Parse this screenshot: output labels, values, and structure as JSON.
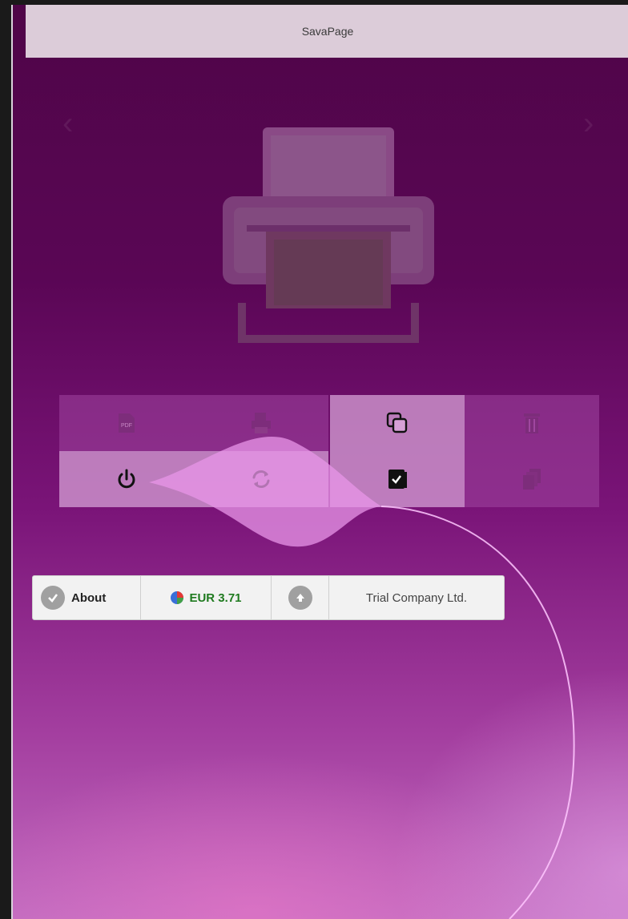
{
  "header": {
    "title": "SavaPage"
  },
  "carousel": {
    "prev_glyph": "‹",
    "next_glyph": "›",
    "hero_icon": "printer-icon"
  },
  "tiles": [
    {
      "icon": "pdf-icon",
      "state": "dim"
    },
    {
      "icon": "print-icon",
      "state": "dim"
    },
    {
      "icon": "copy-icon",
      "state": "lit"
    },
    {
      "icon": "trash-icon",
      "state": "dim"
    },
    {
      "icon": "power-icon",
      "state": "lit"
    },
    {
      "icon": "refresh-icon",
      "state": "lit"
    },
    {
      "icon": "checkbox-icon",
      "state": "lit"
    },
    {
      "icon": "pages-icon",
      "state": "dim"
    }
  ],
  "statusbar": {
    "about_label": "About",
    "balance_label": "EUR 3.71",
    "company_label": "Trial Company Ltd."
  },
  "colors": {
    "accent_purple": "#5a0655",
    "tile_dim": "#a046a0",
    "tile_lit": "#d6a0d6",
    "balance_green": "#1f7a1f"
  }
}
